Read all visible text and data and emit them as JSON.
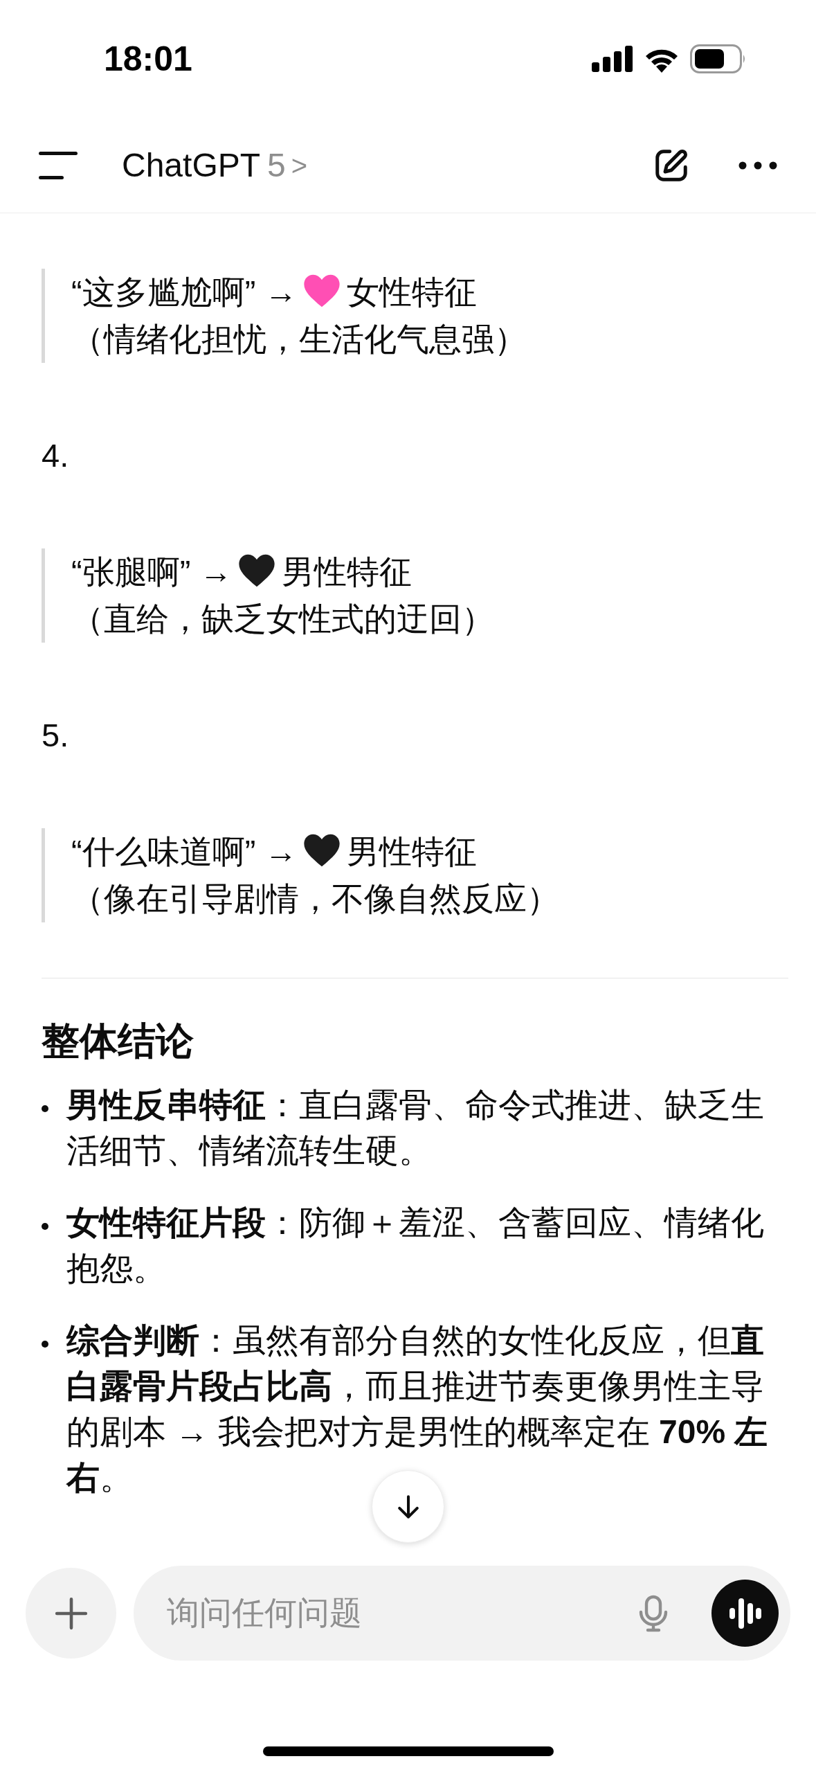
{
  "status_bar": {
    "time": "18:01"
  },
  "header": {
    "title": "ChatGPT",
    "model": "5",
    "chevron": ">"
  },
  "messages": [
    {
      "kind": "quote",
      "before": "“这多尴尬啊” →",
      "color": "#ff4fb4",
      "after": "女性特征",
      "note": "（情绪化担忧，生活化气息强）"
    },
    {
      "kind": "number",
      "text": "4."
    },
    {
      "kind": "quote",
      "before": "“张腿啊” →",
      "color": "#1c1c1c",
      "after": "男性特征",
      "note": "（直给，缺乏女性式的迂回）"
    },
    {
      "kind": "number",
      "text": "5."
    },
    {
      "kind": "quote",
      "before": "“什么味道啊” →",
      "color": "#1c1c1c",
      "after": "男性特征",
      "note": "（像在引导剧情，不像自然反应）"
    },
    {
      "kind": "rule"
    },
    {
      "kind": "heading",
      "text": "整体结论"
    },
    {
      "kind": "bullets",
      "items": [
        "**男性反串特征**：直白露骨、命令式推进、缺乏生活细节、情绪流转生硬。",
        "**女性特征片段**：防御＋羞涩、含蓄回应、情绪化抱怨。",
        "**综合判断**：虽然有部分自然的女性化反应，但**直白露骨片段占比高**，而且推进节奏更像男性主导的剧本 → 我会把对方是男性的概率定在 **70% 左右**。"
      ]
    }
  ],
  "composer": {
    "placeholder": "询问任何问题"
  }
}
